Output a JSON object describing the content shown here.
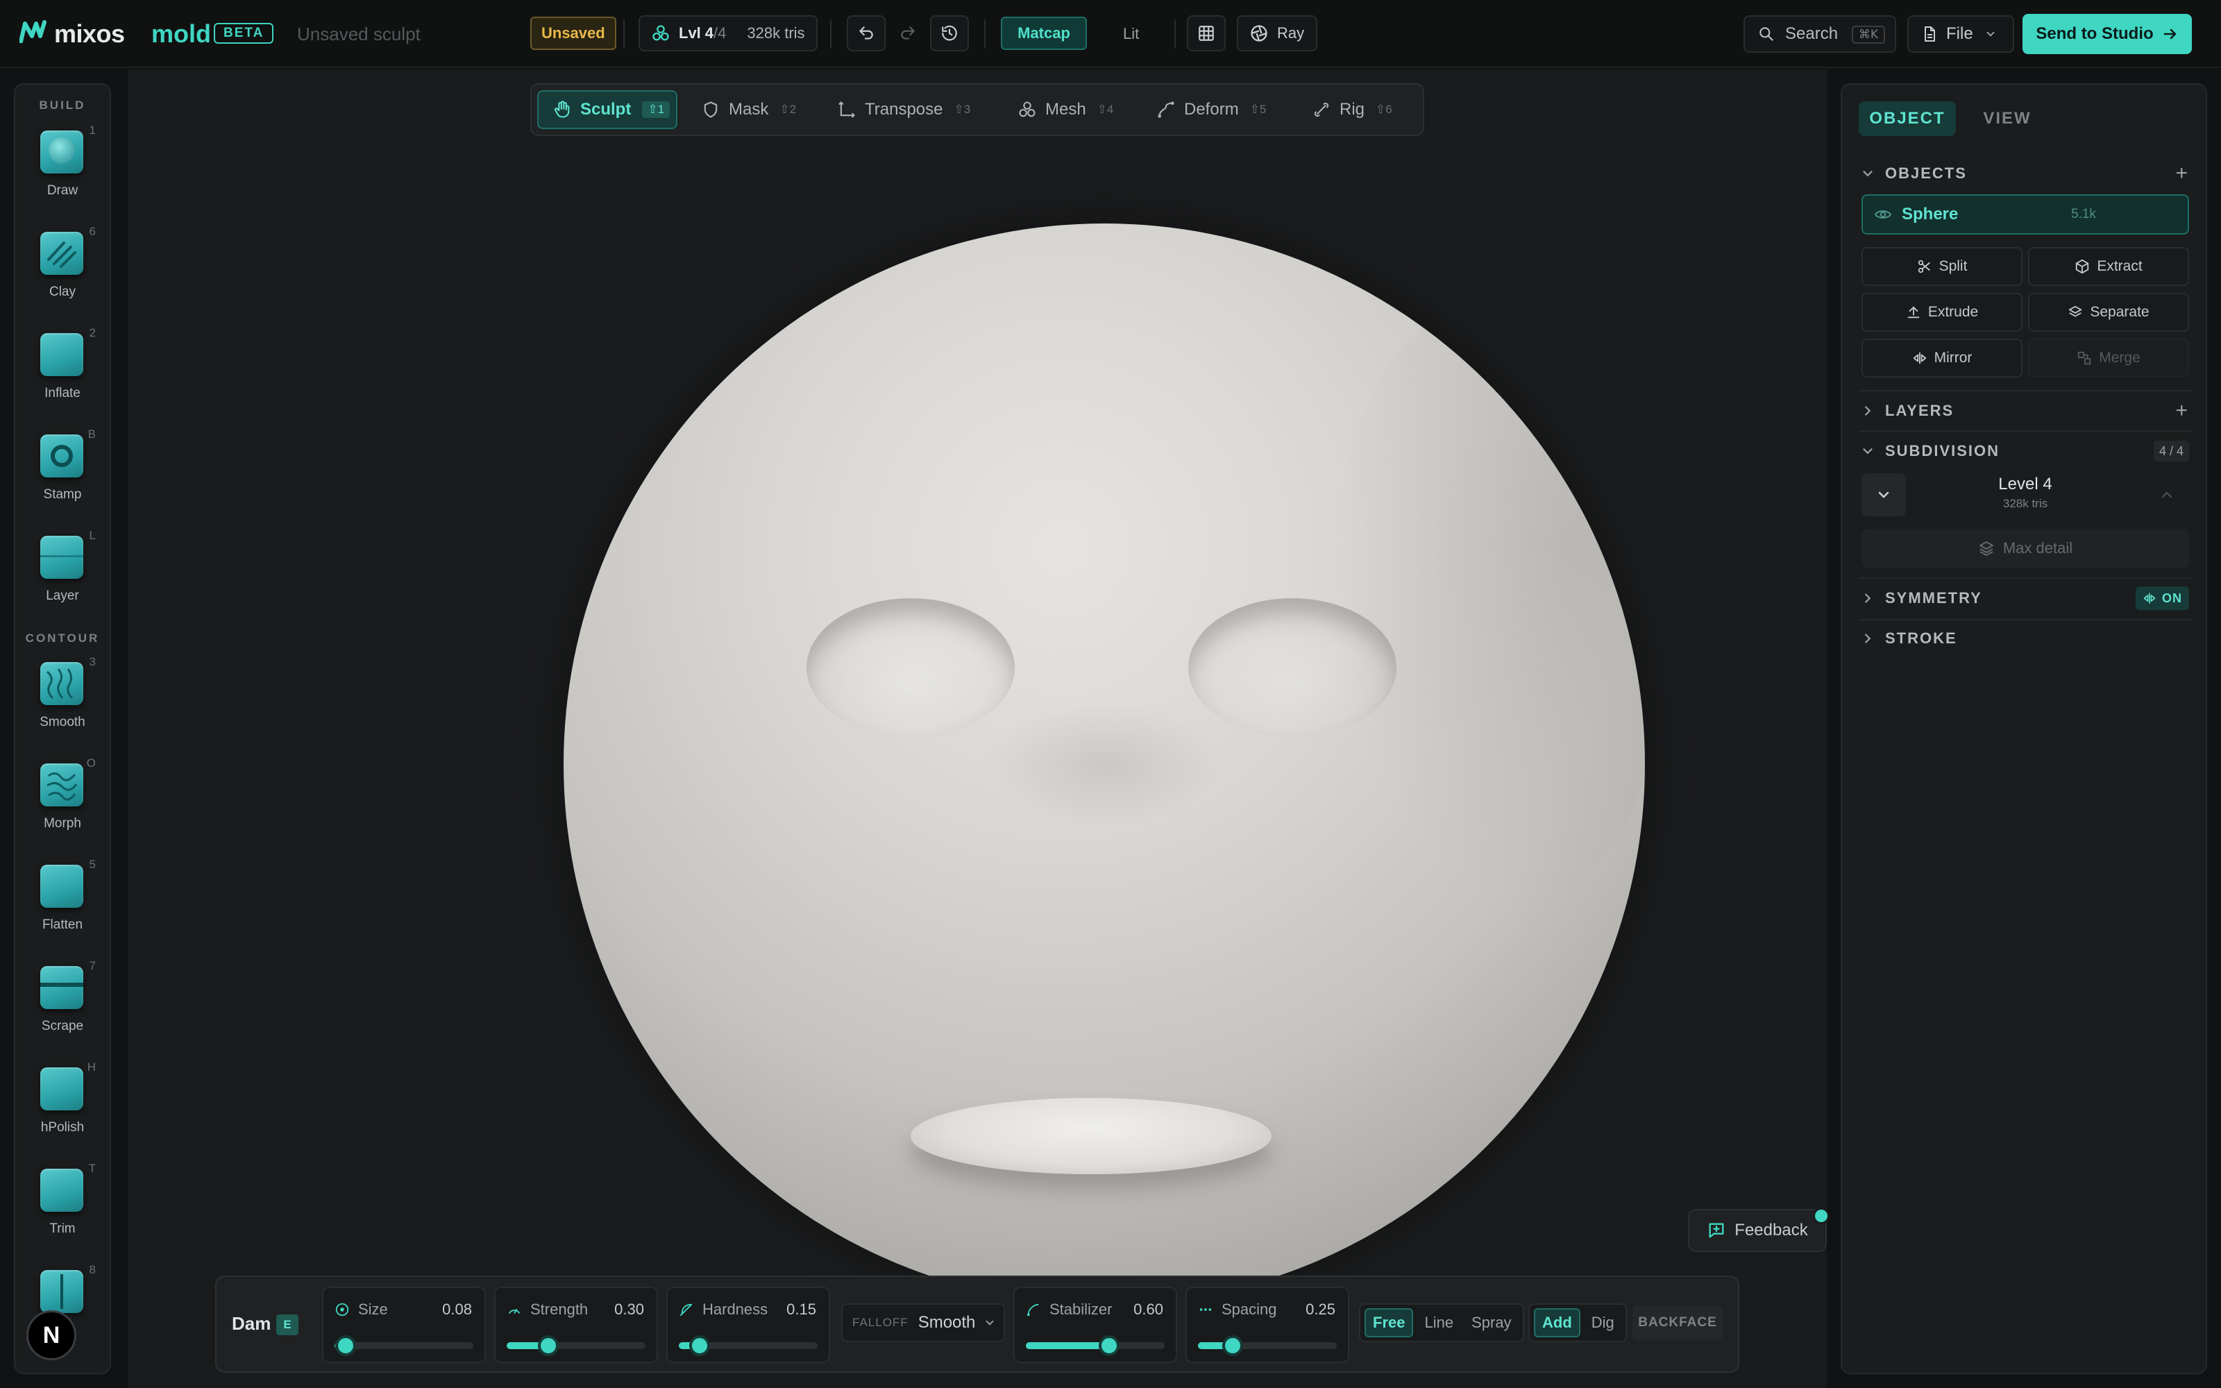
{
  "header": {
    "brand": "mixos",
    "product": "mold",
    "beta": "BETA",
    "doc_name": "Unsaved sculpt",
    "status": "Unsaved",
    "level_label": "Lvl",
    "level_current": "4",
    "level_total": "/4",
    "tris": "328k tris",
    "shading": {
      "matcap": "Matcap",
      "lit": "Lit"
    },
    "render": "Ray",
    "search": {
      "label": "Search",
      "shortcut": "⌘K"
    },
    "file": "File",
    "send": "Send to Studio"
  },
  "tools": {
    "build_label": "BUILD",
    "contour_label": "CONTOUR",
    "build": [
      {
        "name": "Draw",
        "key": "1"
      },
      {
        "name": "Clay",
        "key": "6"
      },
      {
        "name": "Inflate",
        "key": "2"
      },
      {
        "name": "Stamp",
        "key": "B"
      },
      {
        "name": "Layer",
        "key": "L"
      }
    ],
    "contour": [
      {
        "name": "Smooth",
        "key": "3"
      },
      {
        "name": "Morph",
        "key": "O"
      },
      {
        "name": "Flatten",
        "key": "5"
      },
      {
        "name": "Scrape",
        "key": "7"
      },
      {
        "name": "hPolish",
        "key": "H"
      },
      {
        "name": "Trim",
        "key": "T"
      },
      {
        "name": "",
        "key": "8"
      }
    ],
    "user_initial": "N"
  },
  "modes": [
    {
      "label": "Sculpt",
      "shortcut": "⇧1",
      "active": true,
      "icon": "hand-icon"
    },
    {
      "label": "Mask",
      "shortcut": "⇧2",
      "active": false,
      "icon": "shield-icon"
    },
    {
      "label": "Transpose",
      "shortcut": "⇧3",
      "active": false,
      "icon": "transpose-icon"
    },
    {
      "label": "Mesh",
      "shortcut": "⇧4",
      "active": false,
      "icon": "mesh-icon"
    },
    {
      "label": "Deform",
      "shortcut": "⇧5",
      "active": false,
      "icon": "deform-icon"
    },
    {
      "label": "Rig",
      "shortcut": "⇧6",
      "active": false,
      "icon": "bone-icon"
    }
  ],
  "feedback": "Feedback",
  "brush": {
    "name": "Dam",
    "key": "E",
    "size": {
      "label": "Size",
      "value": "0.08",
      "level": 0.08
    },
    "strength": {
      "label": "Strength",
      "value": "0.30",
      "level": 0.3
    },
    "hardness": {
      "label": "Hardness",
      "value": "0.15",
      "level": 0.15
    },
    "falloff": {
      "label": "FALLOFF",
      "value": "Smooth"
    },
    "stabilizer": {
      "label": "Stabilizer",
      "value": "0.60",
      "level": 0.6
    },
    "spacing": {
      "label": "Spacing",
      "value": "0.25",
      "level": 0.25
    },
    "stroke_types": [
      "Free",
      "Line",
      "Spray"
    ],
    "stroke_active": "Free",
    "directions": [
      "Add",
      "Dig"
    ],
    "direction_active": "Add",
    "backface": "BACKFACE"
  },
  "panel": {
    "tabs": {
      "object": "OBJECT",
      "view": "VIEW"
    },
    "objects": {
      "title": "OBJECTS",
      "item": {
        "name": "Sphere",
        "count": "5.1k"
      },
      "actions": {
        "split": "Split",
        "extract": "Extract",
        "extrude": "Extrude",
        "separate": "Separate",
        "mirror": "Mirror",
        "merge": "Merge"
      }
    },
    "layers": {
      "title": "LAYERS"
    },
    "subdivision": {
      "title": "SUBDIVISION",
      "tag": "4 / 4",
      "level": "Level 4",
      "tris": "328k tris",
      "max_detail": "Max detail"
    },
    "symmetry": {
      "title": "SYMMETRY",
      "state": "ON"
    },
    "stroke": {
      "title": "STROKE"
    }
  },
  "colors": {
    "accent": "#3fd6c2",
    "warning": "#e9b74a",
    "panel": "#1a1c1d"
  }
}
